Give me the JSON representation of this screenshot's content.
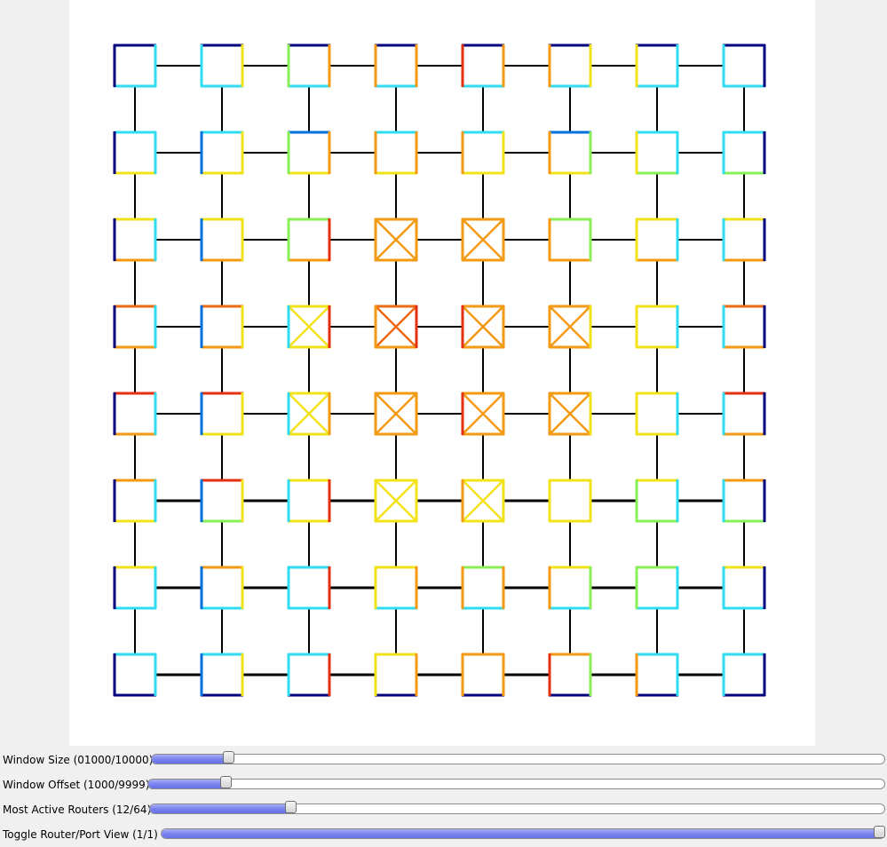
{
  "mesh": {
    "rows": 8,
    "cols": 8,
    "link_color": "#000000",
    "crossed_routers": [
      [
        2,
        3
      ],
      [
        2,
        4
      ],
      [
        3,
        2
      ],
      [
        3,
        3
      ],
      [
        3,
        4
      ],
      [
        3,
        5
      ],
      [
        4,
        2
      ],
      [
        4,
        3
      ],
      [
        4,
        4
      ],
      [
        4,
        5
      ],
      [
        5,
        3
      ],
      [
        5,
        4
      ]
    ],
    "palette": {
      "navy": "#00007f",
      "blue": "#0070dd",
      "cyan": "#2fdcf0",
      "green": "#8aee58",
      "yellow": "#f2e21a",
      "gold": "#f4c40c",
      "orange": "#f49a12",
      "dark-orange": "#ef6a10",
      "red": "#e4300e"
    },
    "routers": [
      [
        {
          "top": "navy",
          "left": "navy",
          "right": "cyan",
          "bottom": "cyan",
          "fill": "white"
        },
        {
          "top": "navy",
          "left": "cyan",
          "right": "yellow",
          "bottom": "cyan",
          "fill": "white"
        },
        {
          "top": "navy",
          "left": "green",
          "right": "orange",
          "bottom": "cyan",
          "fill": "white"
        },
        {
          "top": "navy",
          "left": "orange",
          "right": "orange",
          "bottom": "cyan",
          "fill": "white"
        },
        {
          "top": "navy",
          "left": "red",
          "right": "orange",
          "bottom": "cyan",
          "fill": "white"
        },
        {
          "top": "navy",
          "left": "orange",
          "right": "yellow",
          "bottom": "cyan",
          "fill": "white"
        },
        {
          "top": "navy",
          "left": "yellow",
          "right": "cyan",
          "bottom": "cyan",
          "fill": "white"
        },
        {
          "top": "navy",
          "left": "cyan",
          "right": "navy",
          "bottom": "cyan",
          "fill": "white"
        }
      ],
      [
        {
          "top": "cyan",
          "left": "navy",
          "right": "cyan",
          "bottom": "yellow",
          "fill": "white"
        },
        {
          "top": "cyan",
          "left": "blue",
          "right": "yellow",
          "bottom": "yellow",
          "fill": "white"
        },
        {
          "top": "blue",
          "left": "green",
          "right": "orange",
          "bottom": "yellow",
          "fill": "white"
        },
        {
          "top": "cyan",
          "left": "orange",
          "right": "orange",
          "bottom": "yellow",
          "fill": "white"
        },
        {
          "top": "cyan",
          "left": "orange",
          "right": "yellow",
          "bottom": "yellow",
          "fill": "white"
        },
        {
          "top": "blue",
          "left": "orange",
          "right": "green",
          "bottom": "yellow",
          "fill": "white"
        },
        {
          "top": "cyan",
          "left": "yellow",
          "right": "cyan",
          "bottom": "green",
          "fill": "white"
        },
        {
          "top": "cyan",
          "left": "cyan",
          "right": "navy",
          "bottom": "green",
          "fill": "white"
        }
      ],
      [
        {
          "top": "yellow",
          "left": "navy",
          "right": "cyan",
          "bottom": "orange",
          "fill": "white"
        },
        {
          "top": "yellow",
          "left": "blue",
          "right": "yellow",
          "bottom": "orange",
          "fill": "white"
        },
        {
          "top": "green",
          "left": "green",
          "right": "red",
          "bottom": "orange",
          "fill": "white"
        },
        {
          "top": "orange",
          "left": "orange",
          "right": "orange",
          "bottom": "orange",
          "fill": "white"
        },
        {
          "top": "orange",
          "left": "orange",
          "right": "orange",
          "bottom": "orange",
          "fill": "white"
        },
        {
          "top": "green",
          "left": "orange",
          "right": "green",
          "bottom": "orange",
          "fill": "white"
        },
        {
          "top": "yellow",
          "left": "yellow",
          "right": "cyan",
          "bottom": "orange",
          "fill": "white"
        },
        {
          "top": "yellow",
          "left": "cyan",
          "right": "navy",
          "bottom": "orange",
          "fill": "white"
        }
      ],
      [
        {
          "top": "dark-orange",
          "left": "navy",
          "right": "cyan",
          "bottom": "orange",
          "fill": "white"
        },
        {
          "top": "dark-orange",
          "left": "blue",
          "right": "yellow",
          "bottom": "orange",
          "fill": "white"
        },
        {
          "top": "yellow",
          "left": "cyan",
          "right": "red",
          "bottom": "yellow",
          "fill": "white"
        },
        {
          "top": "dark-orange",
          "left": "orange",
          "right": "red",
          "bottom": "orange",
          "fill": "white"
        },
        {
          "top": "orange",
          "left": "red",
          "right": "orange",
          "bottom": "orange",
          "fill": "white"
        },
        {
          "top": "orange",
          "left": "orange",
          "right": "yellow",
          "bottom": "orange",
          "fill": "white"
        },
        {
          "top": "yellow",
          "left": "yellow",
          "right": "cyan",
          "bottom": "yellow",
          "fill": "white"
        },
        {
          "top": "dark-orange",
          "left": "cyan",
          "right": "navy",
          "bottom": "orange",
          "fill": "white"
        }
      ],
      [
        {
          "top": "red",
          "left": "navy",
          "right": "cyan",
          "bottom": "orange",
          "fill": "white"
        },
        {
          "top": "red",
          "left": "blue",
          "right": "yellow",
          "bottom": "yellow",
          "fill": "white"
        },
        {
          "top": "yellow",
          "left": "cyan",
          "right": "orange",
          "bottom": "yellow",
          "fill": "white"
        },
        {
          "top": "orange",
          "left": "orange",
          "right": "orange",
          "bottom": "orange",
          "fill": "white"
        },
        {
          "top": "orange",
          "left": "red",
          "right": "orange",
          "bottom": "orange",
          "fill": "white"
        },
        {
          "top": "orange",
          "left": "orange",
          "right": "yellow",
          "bottom": "orange",
          "fill": "white"
        },
        {
          "top": "yellow",
          "left": "yellow",
          "right": "cyan",
          "bottom": "yellow",
          "fill": "white"
        },
        {
          "top": "red",
          "left": "cyan",
          "right": "navy",
          "bottom": "orange",
          "fill": "white"
        }
      ],
      [
        {
          "top": "orange",
          "left": "navy",
          "right": "cyan",
          "bottom": "yellow",
          "fill": "white"
        },
        {
          "top": "red",
          "left": "blue",
          "right": "yellow",
          "bottom": "green",
          "fill": "white"
        },
        {
          "top": "yellow",
          "left": "cyan",
          "right": "red",
          "bottom": "yellow",
          "fill": "white"
        },
        {
          "top": "yellow",
          "left": "yellow",
          "right": "yellow",
          "bottom": "yellow",
          "fill": "white"
        },
        {
          "top": "yellow",
          "left": "orange",
          "right": "yellow",
          "bottom": "yellow",
          "fill": "white"
        },
        {
          "top": "yellow",
          "left": "yellow",
          "right": "yellow",
          "bottom": "yellow",
          "fill": "white"
        },
        {
          "top": "yellow",
          "left": "green",
          "right": "cyan",
          "bottom": "green",
          "fill": "white"
        },
        {
          "top": "orange",
          "left": "cyan",
          "right": "navy",
          "bottom": "green",
          "fill": "white"
        }
      ],
      [
        {
          "top": "yellow",
          "left": "navy",
          "right": "cyan",
          "bottom": "cyan",
          "fill": "white"
        },
        {
          "top": "orange",
          "left": "blue",
          "right": "yellow",
          "bottom": "cyan",
          "fill": "white"
        },
        {
          "top": "cyan",
          "left": "cyan",
          "right": "red",
          "bottom": "cyan",
          "fill": "white"
        },
        {
          "top": "yellow",
          "left": "yellow",
          "right": "orange",
          "bottom": "cyan",
          "fill": "white"
        },
        {
          "top": "green",
          "left": "orange",
          "right": "orange",
          "bottom": "cyan",
          "fill": "white"
        },
        {
          "top": "yellow",
          "left": "orange",
          "right": "green",
          "bottom": "cyan",
          "fill": "white"
        },
        {
          "top": "green",
          "left": "green",
          "right": "cyan",
          "bottom": "cyan",
          "fill": "white"
        },
        {
          "top": "yellow",
          "left": "cyan",
          "right": "navy",
          "bottom": "cyan",
          "fill": "white"
        }
      ],
      [
        {
          "top": "cyan",
          "left": "navy",
          "right": "cyan",
          "bottom": "navy",
          "fill": "white"
        },
        {
          "top": "cyan",
          "left": "blue",
          "right": "yellow",
          "bottom": "navy",
          "fill": "white"
        },
        {
          "top": "cyan",
          "left": "cyan",
          "right": "red",
          "bottom": "navy",
          "fill": "white"
        },
        {
          "top": "yellow",
          "left": "yellow",
          "right": "orange",
          "bottom": "navy",
          "fill": "white"
        },
        {
          "top": "orange",
          "left": "orange",
          "right": "orange",
          "bottom": "navy",
          "fill": "white"
        },
        {
          "top": "orange",
          "left": "red",
          "right": "green",
          "bottom": "navy",
          "fill": "white"
        },
        {
          "top": "cyan",
          "left": "orange",
          "right": "cyan",
          "bottom": "navy",
          "fill": "white"
        },
        {
          "top": "cyan",
          "left": "cyan",
          "right": "navy",
          "bottom": "navy",
          "fill": "white"
        }
      ]
    ]
  },
  "sliders": [
    {
      "label": "Window Size (01000/10000)",
      "value": 0.1
    },
    {
      "label": "Window Offset (1000/9999)",
      "value": 0.1
    },
    {
      "label": "Most Active Routers (12/64)",
      "value": 0.1875
    },
    {
      "label": "Toggle Router/Port View (1/1)",
      "value": 1.0
    }
  ]
}
